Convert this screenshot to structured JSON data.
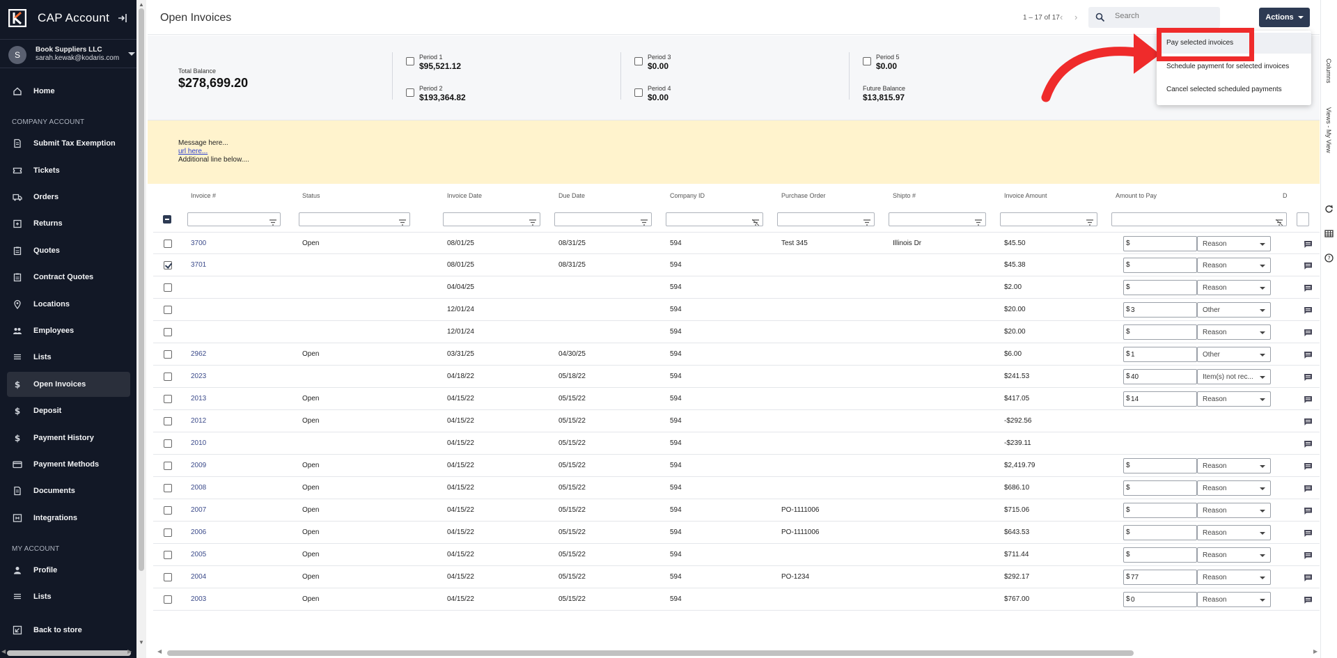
{
  "app": {
    "title": "CAP Account"
  },
  "account": {
    "initial": "S",
    "company": "Book Suppliers LLC",
    "email": "sarah.kewak@kodaris.com"
  },
  "sidebar": {
    "section_company": "COMPANY ACCOUNT",
    "section_my": "MY ACCOUNT",
    "items": [
      {
        "label": "Home",
        "icon": "home-icon"
      },
      {
        "label": "Submit Tax Exemption",
        "icon": "document-icon"
      },
      {
        "label": "Tickets",
        "icon": "ticket-icon"
      },
      {
        "label": "Orders",
        "icon": "truck-icon"
      },
      {
        "label": "Returns",
        "icon": "returns-icon"
      },
      {
        "label": "Quotes",
        "icon": "clipboard-icon"
      },
      {
        "label": "Contract Quotes",
        "icon": "clipboard-icon"
      },
      {
        "label": "Locations",
        "icon": "location-pin-icon"
      },
      {
        "label": "Employees",
        "icon": "people-icon"
      },
      {
        "label": "Lists",
        "icon": "list-icon"
      },
      {
        "label": "Open Invoices",
        "icon": "dollar-icon",
        "active": true
      },
      {
        "label": "Deposit",
        "icon": "dollar-icon"
      },
      {
        "label": "Payment History",
        "icon": "dollar-icon"
      },
      {
        "label": "Payment Methods",
        "icon": "credit-card-icon"
      },
      {
        "label": "Documents",
        "icon": "document-icon"
      },
      {
        "label": "Integrations",
        "icon": "integrations-icon"
      }
    ],
    "my_items": [
      {
        "label": "Profile",
        "icon": "person-icon"
      },
      {
        "label": "Lists",
        "icon": "list-icon"
      }
    ],
    "back": {
      "label": "Back to store",
      "icon": "back-icon"
    }
  },
  "header": {
    "title": "Open Invoices",
    "pager": "1 – 17 of 17",
    "search_placeholder": "Search",
    "actions_label": "Actions"
  },
  "summary": {
    "total_label": "Total Balance",
    "total_value": "$278,699.20",
    "periods": [
      {
        "label": "Period 1",
        "value": "$95,521.12"
      },
      {
        "label": "Period 2",
        "value": "$193,364.82"
      },
      {
        "label": "Period 3",
        "value": "$0.00"
      },
      {
        "label": "Period 4",
        "value": "$0.00"
      },
      {
        "label": "Period 5",
        "value": "$0.00"
      }
    ],
    "future_label": "Future Balance",
    "future_value": "$13,815.97"
  },
  "banner": {
    "line1": "Message here...",
    "line2": "url here...",
    "line3": "Additional line below...."
  },
  "table": {
    "columns": [
      "Invoice #",
      "Status",
      "Invoice Date",
      "Due Date",
      "Company ID",
      "Purchase Order",
      "Shipto #",
      "Invoice Amount",
      "Amount to Pay",
      "D"
    ],
    "rows": [
      {
        "inv": "3700",
        "status": "Open",
        "idate": "08/01/25",
        "due": "08/31/25",
        "cid": "594",
        "po": "Test 345",
        "shipto": "Illinois Dr",
        "amt": "$45.50",
        "pay": "",
        "reason": "Reason",
        "checked": false,
        "editable": true
      },
      {
        "inv": "3701",
        "status": "",
        "idate": "08/01/25",
        "due": "08/31/25",
        "cid": "594",
        "po": "",
        "shipto": "",
        "amt": "$45.38",
        "pay": "",
        "reason": "Reason",
        "checked": true,
        "editable": true
      },
      {
        "inv": "",
        "status": "",
        "idate": "04/04/25",
        "due": "",
        "cid": "594",
        "po": "",
        "shipto": "",
        "amt": "$2.00",
        "pay": "",
        "reason": "Reason",
        "checked": false,
        "editable": true
      },
      {
        "inv": "",
        "status": "",
        "idate": "12/01/24",
        "due": "",
        "cid": "594",
        "po": "",
        "shipto": "",
        "amt": "$20.00",
        "pay": "3",
        "reason": "Other",
        "checked": false,
        "editable": true
      },
      {
        "inv": "",
        "status": "",
        "idate": "12/01/24",
        "due": "",
        "cid": "594",
        "po": "",
        "shipto": "",
        "amt": "$20.00",
        "pay": "",
        "reason": "Reason",
        "checked": false,
        "editable": true
      },
      {
        "inv": "2962",
        "status": "Open",
        "idate": "03/31/25",
        "due": "04/30/25",
        "cid": "594",
        "po": "",
        "shipto": "",
        "amt": "$6.00",
        "pay": "1",
        "reason": "Other",
        "checked": false,
        "editable": true
      },
      {
        "inv": "2023",
        "status": "",
        "idate": "04/18/22",
        "due": "05/18/22",
        "cid": "594",
        "po": "",
        "shipto": "",
        "amt": "$241.53",
        "pay": "40",
        "reason": "Item(s) not rec...",
        "checked": false,
        "editable": true
      },
      {
        "inv": "2013",
        "status": "Open",
        "idate": "04/15/22",
        "due": "05/15/22",
        "cid": "594",
        "po": "",
        "shipto": "",
        "amt": "$417.05",
        "pay": "14",
        "reason": "Reason",
        "checked": false,
        "editable": true
      },
      {
        "inv": "2012",
        "status": "Open",
        "idate": "04/15/22",
        "due": "05/15/22",
        "cid": "594",
        "po": "",
        "shipto": "",
        "amt": "-$292.56",
        "pay": "",
        "reason": "",
        "checked": false,
        "editable": false
      },
      {
        "inv": "2010",
        "status": "",
        "idate": "04/15/22",
        "due": "05/15/22",
        "cid": "594",
        "po": "",
        "shipto": "",
        "amt": "-$239.11",
        "pay": "",
        "reason": "",
        "checked": false,
        "editable": false
      },
      {
        "inv": "2009",
        "status": "Open",
        "idate": "04/15/22",
        "due": "05/15/22",
        "cid": "594",
        "po": "",
        "shipto": "",
        "amt": "$2,419.79",
        "pay": "",
        "reason": "Reason",
        "checked": false,
        "editable": true
      },
      {
        "inv": "2008",
        "status": "Open",
        "idate": "04/15/22",
        "due": "05/15/22",
        "cid": "594",
        "po": "",
        "shipto": "",
        "amt": "$686.10",
        "pay": "",
        "reason": "Reason",
        "checked": false,
        "editable": true
      },
      {
        "inv": "2007",
        "status": "Open",
        "idate": "04/15/22",
        "due": "05/15/22",
        "cid": "594",
        "po": "PO-1111006",
        "shipto": "",
        "amt": "$715.06",
        "pay": "",
        "reason": "Reason",
        "checked": false,
        "editable": true
      },
      {
        "inv": "2006",
        "status": "Open",
        "idate": "04/15/22",
        "due": "05/15/22",
        "cid": "594",
        "po": "PO-1111006",
        "shipto": "",
        "amt": "$643.53",
        "pay": "",
        "reason": "Reason",
        "checked": false,
        "editable": true
      },
      {
        "inv": "2005",
        "status": "Open",
        "idate": "04/15/22",
        "due": "05/15/22",
        "cid": "594",
        "po": "",
        "shipto": "",
        "amt": "$711.44",
        "pay": "",
        "reason": "Reason",
        "checked": false,
        "editable": true
      },
      {
        "inv": "2004",
        "status": "Open",
        "idate": "04/15/22",
        "due": "05/15/22",
        "cid": "594",
        "po": "PO-1234",
        "shipto": "",
        "amt": "$292.17",
        "pay": "77",
        "reason": "Reason",
        "checked": false,
        "editable": true
      },
      {
        "inv": "2003",
        "status": "Open",
        "idate": "04/15/22",
        "due": "05/15/22",
        "cid": "594",
        "po": "",
        "shipto": "",
        "amt": "$767.00",
        "pay": "0",
        "reason": "Reason",
        "checked": false,
        "editable": true
      }
    ],
    "currency_symbol": "$"
  },
  "actions_menu": {
    "items": [
      "Pay selected invoices",
      "Schedule payment for selected invoices",
      "Cancel selected scheduled payments"
    ]
  },
  "right_rail": {
    "columns": "Columns",
    "views": "Views - My View"
  },
  "colors": {
    "sidebar_bg": "#121826",
    "accent": "#2d3a53",
    "banner_bg": "#fff3cd",
    "annotation_red": "#ef2b2b"
  }
}
